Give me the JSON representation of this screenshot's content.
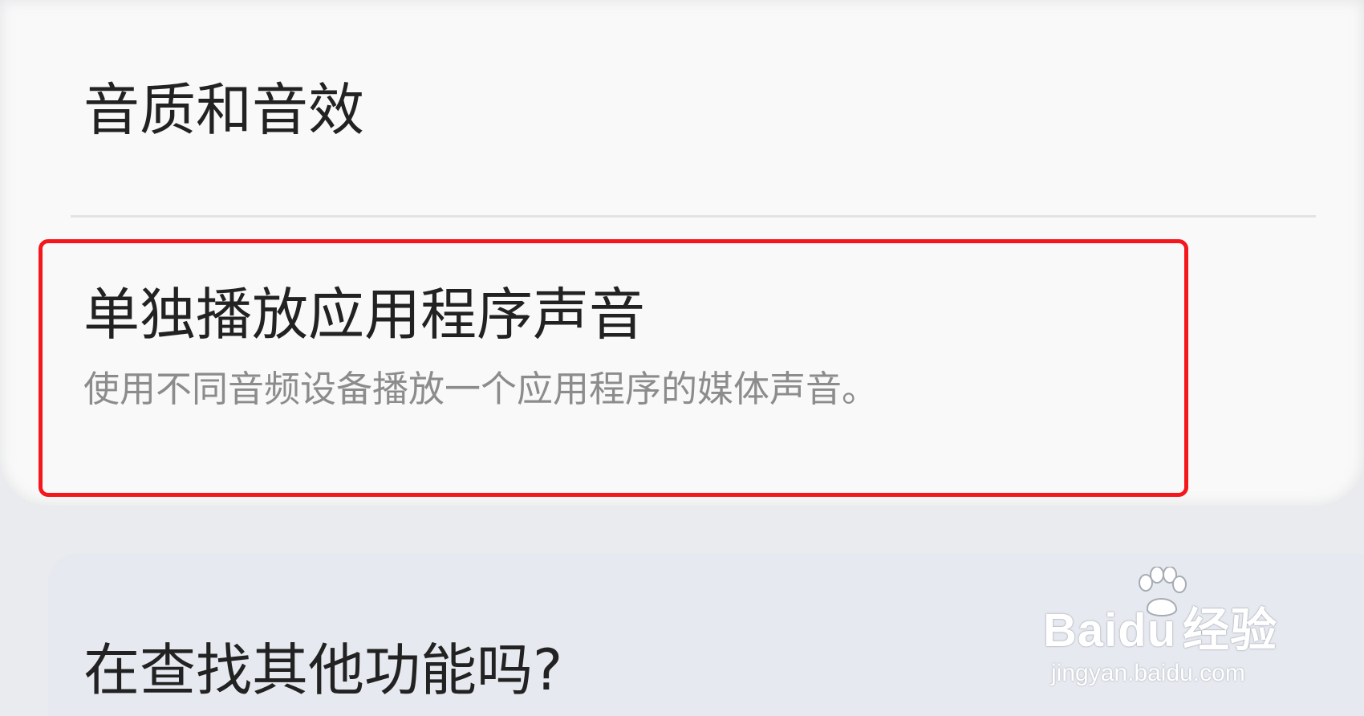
{
  "settings": {
    "items": [
      {
        "title": "音质和音效"
      },
      {
        "title": "单独播放应用程序声音",
        "subtitle": "使用不同音频设备播放一个应用程序的媒体声音。"
      }
    ],
    "bottom_card": {
      "title": "在查找其他功能吗?"
    }
  },
  "annotation": {
    "highlight_color": "#f4171b"
  },
  "watermark": {
    "logo_text": "Bai",
    "logo_suffix": "du",
    "logo_cn": "经验",
    "url": "jingyan.baidu.com"
  }
}
